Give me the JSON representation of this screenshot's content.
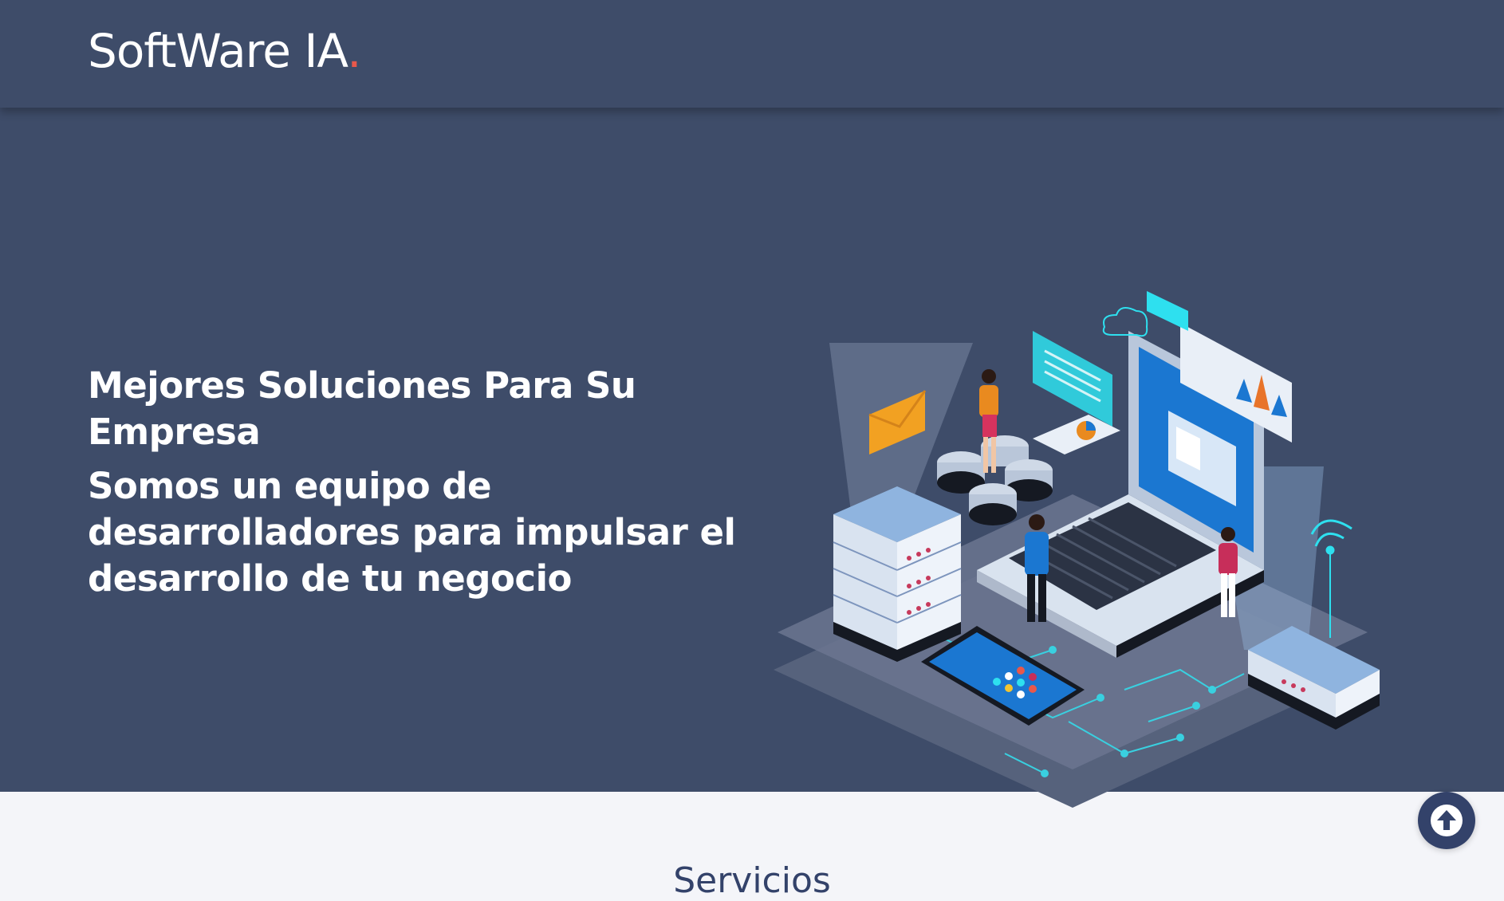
{
  "navbar": {
    "brand_text": "SoftWare IA",
    "brand_dot": ".",
    "accent_color": "#e8584b",
    "background_color": "#3e4c69"
  },
  "hero": {
    "title": "Mejores Soluciones Para Su Empresa",
    "subtitle": "Somos un equipo de desarrolladores para impulsar el desarrollo de tu negocio",
    "illustration": "isometric-tech-illustration"
  },
  "services": {
    "title": "Servicios"
  },
  "scroll_top": {
    "icon": "arrow-up-icon",
    "color": "#33426a"
  }
}
